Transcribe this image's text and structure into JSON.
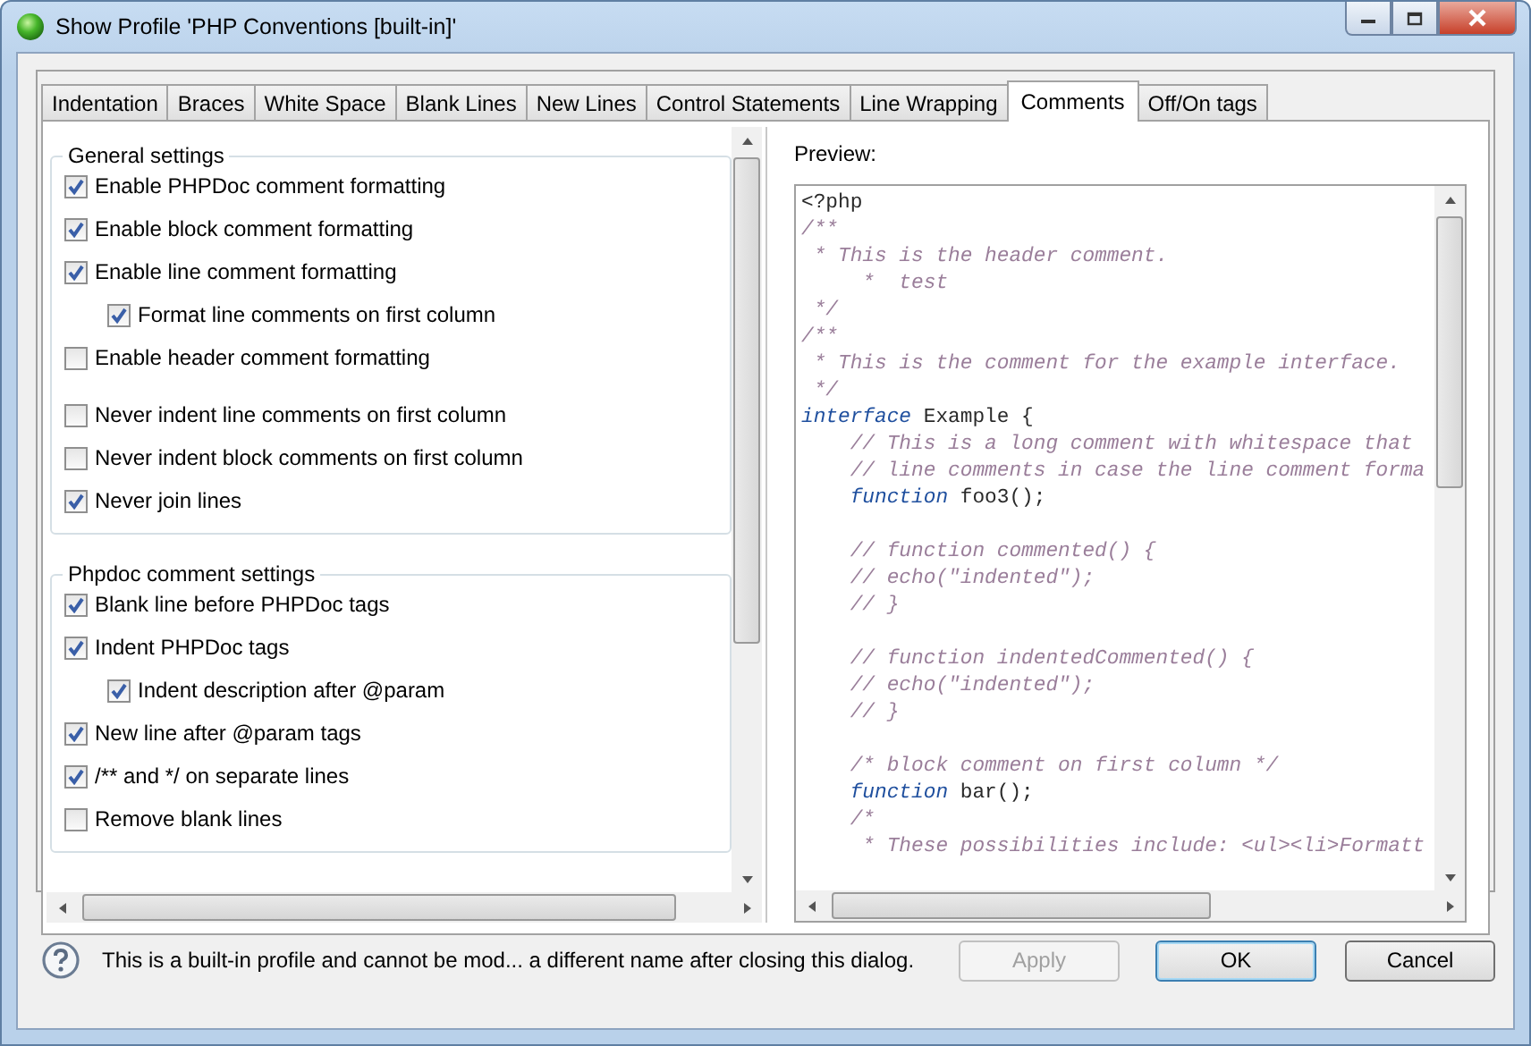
{
  "window": {
    "title": "Show Profile 'PHP Conventions [built-in]'"
  },
  "tabs": [
    {
      "label": "Indentation",
      "selected": false
    },
    {
      "label": "Braces",
      "selected": false
    },
    {
      "label": "White Space",
      "selected": false
    },
    {
      "label": "Blank Lines",
      "selected": false
    },
    {
      "label": "New Lines",
      "selected": false
    },
    {
      "label": "Control Statements",
      "selected": false
    },
    {
      "label": "Line Wrapping",
      "selected": false
    },
    {
      "label": "Comments",
      "selected": true
    },
    {
      "label": "Off/On tags",
      "selected": false
    }
  ],
  "settings_groups": [
    {
      "title": "General settings",
      "items": [
        {
          "label": "Enable PHPDoc comment formatting",
          "checked": true
        },
        {
          "label": "Enable block comment formatting",
          "checked": true
        },
        {
          "label": "Enable line comment formatting",
          "checked": true,
          "children": [
            {
              "label": "Format line comments on first column",
              "checked": true
            }
          ]
        },
        {
          "label": "Enable header comment formatting",
          "checked": false
        },
        {
          "label": "Never indent line comments on first column",
          "checked": false
        },
        {
          "label": "Never indent block comments on first column",
          "checked": false
        },
        {
          "label": "Never join lines",
          "checked": true
        }
      ]
    },
    {
      "title": "Phpdoc comment settings",
      "items": [
        {
          "label": "Blank line before PHPDoc tags",
          "checked": true
        },
        {
          "label": "Indent PHPDoc tags",
          "checked": true,
          "children": [
            {
              "label": "Indent description after @param",
              "checked": true
            }
          ]
        },
        {
          "label": "New line after @param tags",
          "checked": true
        },
        {
          "label": "/** and */ on separate lines",
          "checked": true
        },
        {
          "label": "Remove blank lines",
          "checked": false
        }
      ]
    }
  ],
  "preview": {
    "label": "Preview:",
    "lines": [
      {
        "kind": "code",
        "segments": [
          {
            "kind": "plain",
            "text": "<?php"
          }
        ]
      },
      {
        "kind": "code",
        "segments": [
          {
            "kind": "comment",
            "text": "/**"
          }
        ]
      },
      {
        "kind": "code",
        "segments": [
          {
            "kind": "comment",
            "text": " * This is the header comment."
          }
        ]
      },
      {
        "kind": "code",
        "segments": [
          {
            "kind": "comment",
            "text": "     *  test"
          }
        ]
      },
      {
        "kind": "code",
        "segments": [
          {
            "kind": "comment",
            "text": " */"
          }
        ]
      },
      {
        "kind": "code",
        "segments": [
          {
            "kind": "comment",
            "text": "/**"
          }
        ]
      },
      {
        "kind": "code",
        "segments": [
          {
            "kind": "comment",
            "text": " * This is the comment for the example interface."
          }
        ]
      },
      {
        "kind": "code",
        "segments": [
          {
            "kind": "comment",
            "text": " */"
          }
        ]
      },
      {
        "kind": "code",
        "segments": [
          {
            "kind": "keyword",
            "text": "interface"
          },
          {
            "kind": "plain",
            "text": " Example {"
          }
        ]
      },
      {
        "kind": "code",
        "segments": [
          {
            "kind": "comment",
            "text": "    // This is a long comment with whitespace that"
          }
        ]
      },
      {
        "kind": "code",
        "segments": [
          {
            "kind": "comment",
            "text": "    // line comments in case the line comment forma"
          }
        ]
      },
      {
        "kind": "code",
        "segments": [
          {
            "kind": "keyword",
            "text": "    function"
          },
          {
            "kind": "plain",
            "text": " foo3();"
          }
        ]
      },
      {
        "kind": "blank"
      },
      {
        "kind": "code",
        "segments": [
          {
            "kind": "comment",
            "text": "    // function commented() {"
          }
        ]
      },
      {
        "kind": "code",
        "segments": [
          {
            "kind": "comment",
            "text": "    // echo(\"indented\");"
          }
        ]
      },
      {
        "kind": "code",
        "segments": [
          {
            "kind": "comment",
            "text": "    // }"
          }
        ]
      },
      {
        "kind": "blank"
      },
      {
        "kind": "code",
        "segments": [
          {
            "kind": "comment",
            "text": "    // function indentedCommented() {"
          }
        ]
      },
      {
        "kind": "code",
        "segments": [
          {
            "kind": "comment",
            "text": "    // echo(\"indented\");"
          }
        ]
      },
      {
        "kind": "code",
        "segments": [
          {
            "kind": "comment",
            "text": "    // }"
          }
        ]
      },
      {
        "kind": "blank"
      },
      {
        "kind": "code",
        "segments": [
          {
            "kind": "comment",
            "text": "    /* block comment on first column */"
          }
        ]
      },
      {
        "kind": "code",
        "segments": [
          {
            "kind": "keyword",
            "text": "    function"
          },
          {
            "kind": "plain",
            "text": " bar();"
          }
        ]
      },
      {
        "kind": "code",
        "segments": [
          {
            "kind": "comment",
            "text": "    /*"
          }
        ]
      },
      {
        "kind": "code",
        "segments": [
          {
            "kind": "comment",
            "text": "     * These possibilities include: <ul><li>Formatt"
          }
        ]
      }
    ]
  },
  "footer": {
    "message": "This is a built-in profile and cannot be mod... a different name after closing this dialog.",
    "buttons": [
      {
        "label": "Apply",
        "disabled": true,
        "default": false
      },
      {
        "label": "OK",
        "disabled": false,
        "default": true
      },
      {
        "label": "Cancel",
        "disabled": false,
        "default": false
      }
    ]
  }
}
